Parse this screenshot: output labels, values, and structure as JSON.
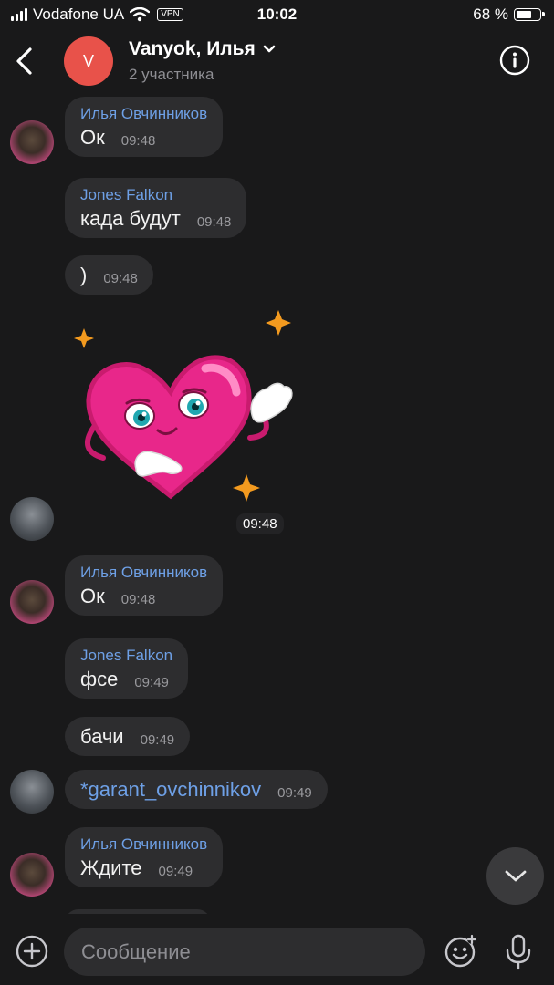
{
  "status_bar": {
    "carrier": "Vodafone UA",
    "vpn": "VPN",
    "time": "10:02",
    "battery": "68 %",
    "battery_level": 0.68
  },
  "header": {
    "title": "Vanyok, Илья",
    "subtitle": "2 участника",
    "avatar_letter": "V",
    "avatar_color": "#e8524a"
  },
  "messages": [
    {
      "sender": "Илья Овчинников",
      "text": "Ок",
      "time": "09:48"
    },
    {
      "sender": "Jones Falkon",
      "text": "када будут",
      "time": "09:48"
    },
    {
      "text": ")",
      "time": "09:48"
    },
    {
      "type": "sticker",
      "sticker": "heart-sticker",
      "time": "09:48"
    },
    {
      "sender": "Илья Овчинников",
      "text": "Ок",
      "time": "09:48"
    },
    {
      "sender": "Jones Falkon",
      "text": "фсе",
      "time": "09:49"
    },
    {
      "text": "бачи",
      "time": "09:49"
    },
    {
      "text": "*garant_ovchinnikov",
      "time": "09:49"
    },
    {
      "sender": "Илья Овчинников",
      "text": "Ждите",
      "time": "09:49"
    }
  ],
  "composer": {
    "placeholder": "Сообщение"
  },
  "icons": [
    "chevron-left-icon",
    "chevron-down-icon",
    "info-icon",
    "chevron-down-icon",
    "plus-circle-icon",
    "emoji-icon",
    "microphone-icon"
  ],
  "colors": {
    "background": "#19191a",
    "bubble": "#2d2d2f",
    "accent": "#6ea0e6"
  }
}
